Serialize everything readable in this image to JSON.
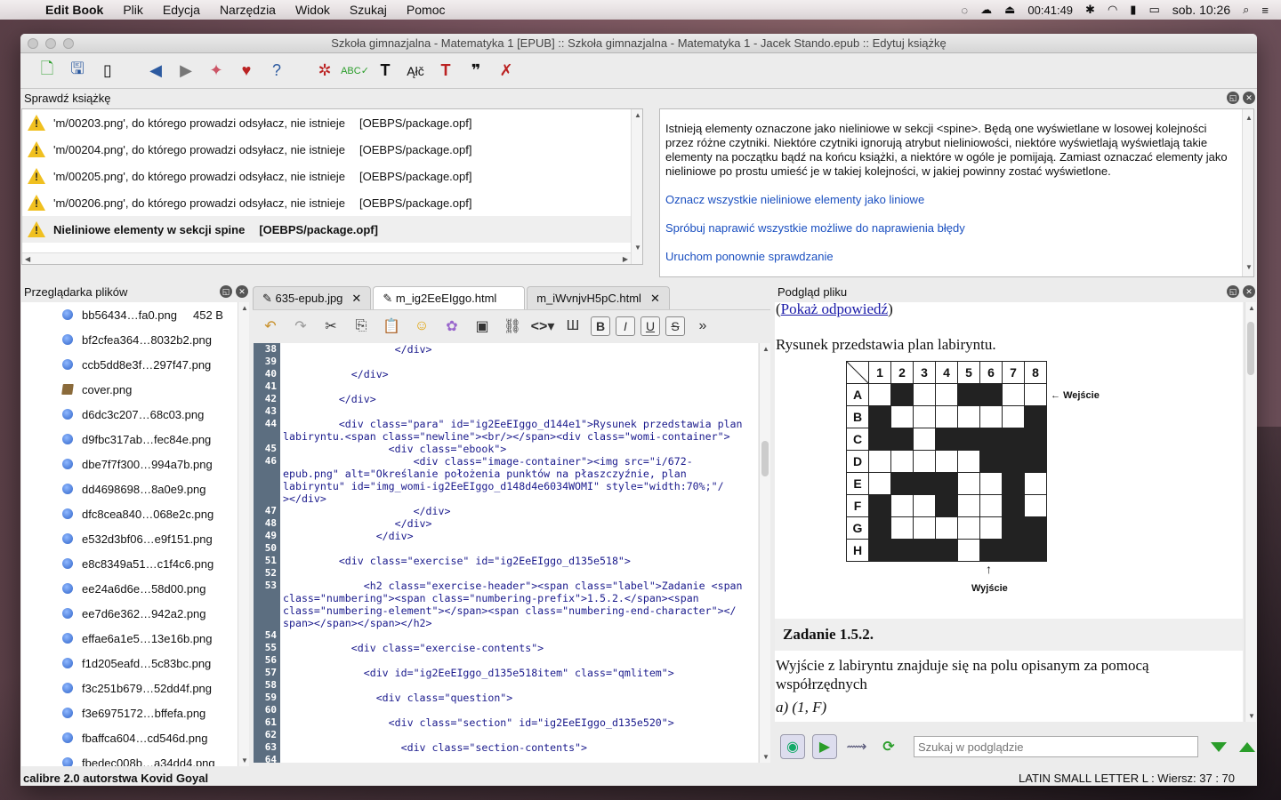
{
  "menubar": {
    "app": "Edit Book",
    "items": [
      "Plik",
      "Edycja",
      "Narzędzia",
      "Widok",
      "Szukaj",
      "Pomoc"
    ],
    "timer": "00:41:49",
    "clock": "sob. 10:26"
  },
  "window": {
    "title": "Szkoła gimnazjalna - Matematyka 1 [EPUB] :: Szkoła gimnazjalna - Matematyka 1 - Jacek Stando.epub :: Edytuj książkę"
  },
  "toolbar": {
    "icons": [
      "new-file-icon",
      "save-icon",
      "import-icon",
      "back-icon",
      "forward-icon",
      "checkpoint-icon",
      "donate-heart-icon",
      "help-icon",
      "bug-check-icon",
      "spellcheck-icon",
      "text-icon",
      "special-chars-icon",
      "typography-icon",
      "quote-icon",
      "tools-icon"
    ]
  },
  "check": {
    "title": "Sprawdź książkę",
    "rows": [
      {
        "msg": "'m/00203.png', do którego prowadzi odsyłacz, nie istnieje",
        "file": "[OEBPS/package.opf]"
      },
      {
        "msg": "'m/00204.png', do którego prowadzi odsyłacz, nie istnieje",
        "file": "[OEBPS/package.opf]"
      },
      {
        "msg": "'m/00205.png', do którego prowadzi odsyłacz, nie istnieje",
        "file": "[OEBPS/package.opf]"
      },
      {
        "msg": "'m/00206.png', do którego prowadzi odsyłacz, nie istnieje",
        "file": "[OEBPS/package.opf]"
      },
      {
        "msg": "Nieliniowe elementy w sekcji spine",
        "file": "[OEBPS/package.opf]"
      }
    ],
    "description": "Istnieją elementy oznaczone jako nieliniowe w sekcji <spine>. Będą one wyświetlane w losowej kolejności przez różne czytniki. Niektóre czytniki ignorują atrybut nieliniowości, niektóre wyświetlają wyświetlają takie elementy na początku bądź na końcu książki, a niektóre w ogóle je pomijają. Zamiast oznaczać elementy jako nieliniowe po prostu umieść je w takiej kolejności, w jakiej powinny zostać wyświetlone.",
    "links": [
      "Oznacz wszystkie nieliniowe elementy jako liniowe",
      "Spróbuj naprawić wszystkie możliwe do naprawienia błędy",
      "Uruchom ponownie sprawdzanie"
    ]
  },
  "files": {
    "title": "Przeglądarka plików",
    "items": [
      {
        "name": "bb56434…fa0.png",
        "size": "452 B"
      },
      {
        "name": "bf2cfea364…8032b2.png",
        "size": ""
      },
      {
        "name": "ccb5dd8e3f…297f47.png",
        "size": ""
      },
      {
        "name": "cover.png",
        "size": "",
        "book": true
      },
      {
        "name": "d6dc3c207…68c03.png",
        "size": ""
      },
      {
        "name": "d9fbc317ab…fec84e.png",
        "size": ""
      },
      {
        "name": "dbe7f7f300…994a7b.png",
        "size": ""
      },
      {
        "name": "dd4698698…8a0e9.png",
        "size": ""
      },
      {
        "name": "dfc8cea840…068e2c.png",
        "size": ""
      },
      {
        "name": "e532d3bf06…e9f151.png",
        "size": ""
      },
      {
        "name": "e8c8349a51…c1f4c6.png",
        "size": ""
      },
      {
        "name": "ee24a6d6e…58d00.png",
        "size": ""
      },
      {
        "name": "ee7d6e362…942a2.png",
        "size": ""
      },
      {
        "name": "effae6a1e5…13e16b.png",
        "size": ""
      },
      {
        "name": "f1d205eafd…5c83bc.png",
        "size": ""
      },
      {
        "name": "f3c251b679…52dd4f.png",
        "size": ""
      },
      {
        "name": "f3e6975172…bffefa.png",
        "size": ""
      },
      {
        "name": "fbaffca604…cd546d.png",
        "size": ""
      },
      {
        "name": "fbedec008b…a34dd4.png",
        "size": ""
      }
    ]
  },
  "editor": {
    "tabs": [
      "635-epub.jpg",
      "m_ig2EeEIggo.html",
      "m_iWvnjvH5pC.html"
    ],
    "lines": [
      {
        "n": "38",
        "t": "                  </div>"
      },
      {
        "n": "39",
        "t": ""
      },
      {
        "n": "40",
        "t": "           </div>"
      },
      {
        "n": "41",
        "t": ""
      },
      {
        "n": "42",
        "t": "         </div>"
      },
      {
        "n": "43",
        "t": ""
      },
      {
        "n": "44",
        "t": "         <div class=\"para\" id=\"ig2EeEIggo_d144e1\">Rysunek przedstawia plan"
      },
      {
        "n": "",
        "t": "labiryntu.<span class=\"newline\"><br/></span><div class=\"womi-container\">"
      },
      {
        "n": "45",
        "t": "                 <div class=\"ebook\">"
      },
      {
        "n": "46",
        "t": "                     <div class=\"image-container\"><img src=\"i/672-"
      },
      {
        "n": "",
        "t": "epub.png\" alt=\"Określanie położenia punktów na płaszczyźnie, plan"
      },
      {
        "n": "",
        "t": "labiryntu\" id=\"img_womi-ig2EeEIggo_d148d4e6034WOMI\" style=\"width:70%;\"/"
      },
      {
        "n": "",
        "t": "></div>"
      },
      {
        "n": "47",
        "t": "                     </div>"
      },
      {
        "n": "48",
        "t": "                  </div>"
      },
      {
        "n": "49",
        "t": "               </div>"
      },
      {
        "n": "50",
        "t": ""
      },
      {
        "n": "51",
        "t": "         <div class=\"exercise\" id=\"ig2EeEIggo_d135e518\">"
      },
      {
        "n": "52",
        "t": ""
      },
      {
        "n": "53",
        "t": "             <h2 class=\"exercise-header\"><span class=\"label\">Zadanie <span"
      },
      {
        "n": "",
        "t": "class=\"numbering\"><span class=\"numbering-prefix\">1.5.2.</span><span"
      },
      {
        "n": "",
        "t": "class=\"numbering-element\"></span><span class=\"numbering-end-character\"></"
      },
      {
        "n": "",
        "t": "span></span></span></h2>"
      },
      {
        "n": "54",
        "t": ""
      },
      {
        "n": "55",
        "t": "           <div class=\"exercise-contents\">"
      },
      {
        "n": "56",
        "t": ""
      },
      {
        "n": "57",
        "t": "             <div id=\"ig2EeEIggo_d135e518item\" class=\"qmlitem\">"
      },
      {
        "n": "58",
        "t": ""
      },
      {
        "n": "59",
        "t": "               <div class=\"question\">"
      },
      {
        "n": "60",
        "t": ""
      },
      {
        "n": "61",
        "t": "                 <div class=\"section\" id=\"ig2EeEIggo_d135e520\">"
      },
      {
        "n": "62",
        "t": ""
      },
      {
        "n": "63",
        "t": "                   <div class=\"section-contents\">"
      },
      {
        "n": "64",
        "t": ""
      }
    ]
  },
  "preview": {
    "title": "Podgląd pliku",
    "answer_link": "Pokaż odpowiedź",
    "para": "Rysunek przedstawia plan labiryntu.",
    "maze": {
      "cols": [
        "1",
        "2",
        "3",
        "4",
        "5",
        "6",
        "7",
        "8"
      ],
      "rows": [
        "A",
        "B",
        "C",
        "D",
        "E",
        "F",
        "G",
        "H"
      ],
      "black": [
        [
          2,
          5,
          6
        ],
        [
          1,
          8
        ],
        [
          1,
          2,
          4,
          5,
          6,
          7,
          8
        ],
        [
          6,
          7,
          8
        ],
        [
          2,
          3,
          4,
          7
        ],
        [
          1,
          4,
          7
        ],
        [
          1,
          7,
          8
        ],
        [
          1,
          2,
          3,
          4,
          6,
          7,
          8
        ]
      ],
      "entry": "Wejście",
      "exit": "Wyjście"
    },
    "exercise": "Zadanie 1.5.2.",
    "question": "Wyjście z labiryntu znajduje się na polu opisanym za pomocą współrzędnych",
    "option_a": "a) (1, F)",
    "search_placeholder": "Szukaj w podglądzie"
  },
  "status": {
    "left": "calibre 2.0 autorstwa Kovid Goyal",
    "right": "LATIN SMALL LETTER L : Wiersz: 37 : 70"
  }
}
